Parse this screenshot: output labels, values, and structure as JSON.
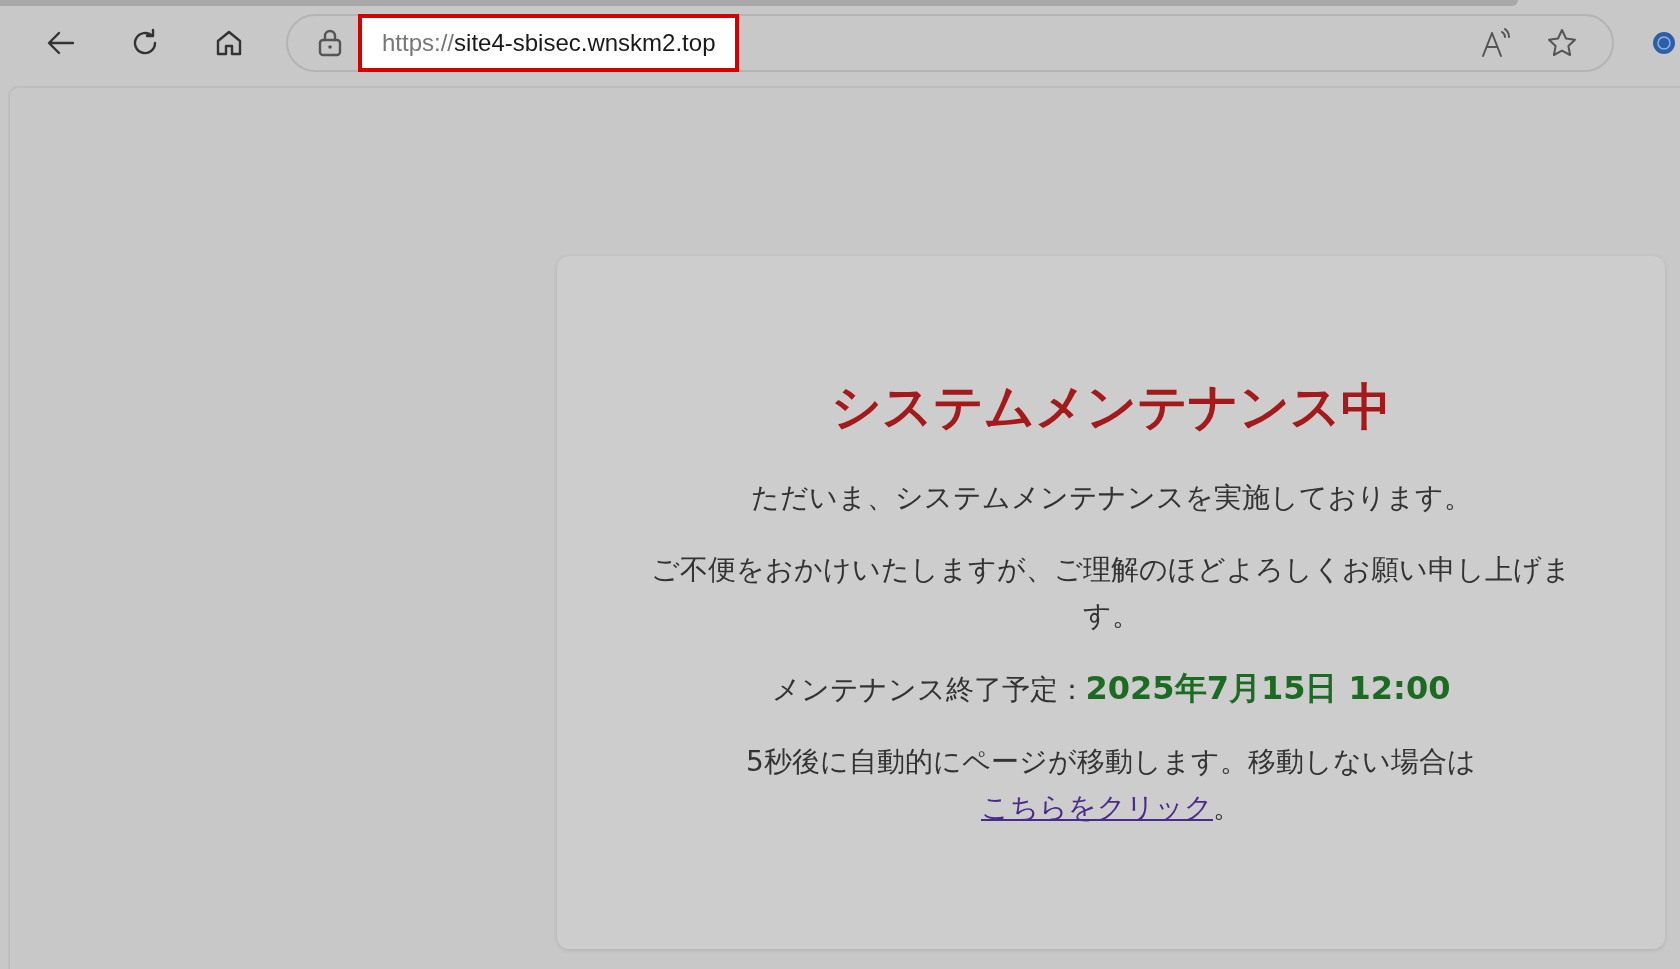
{
  "browser": {
    "address_bar": {
      "url_scheme": "https://",
      "url_host": "site4-sbisec.wnskm2.top",
      "highlighted": true
    }
  },
  "page": {
    "title": "システムメンテナンス中",
    "paragraphs": [
      "ただいま、システムメンテナンスを実施しております。",
      "ご不便をおかけいたしますが、ご理解のほどよろしくお願い申し上げます。"
    ],
    "end_label": "メンテナンス終了予定：",
    "end_time": "2025年7月15日 12:00",
    "redirect_text": "5秒後に自動的にページが移動します。移動しない場合は ",
    "redirect_link": "こちらをクリック",
    "redirect_end": "。"
  }
}
